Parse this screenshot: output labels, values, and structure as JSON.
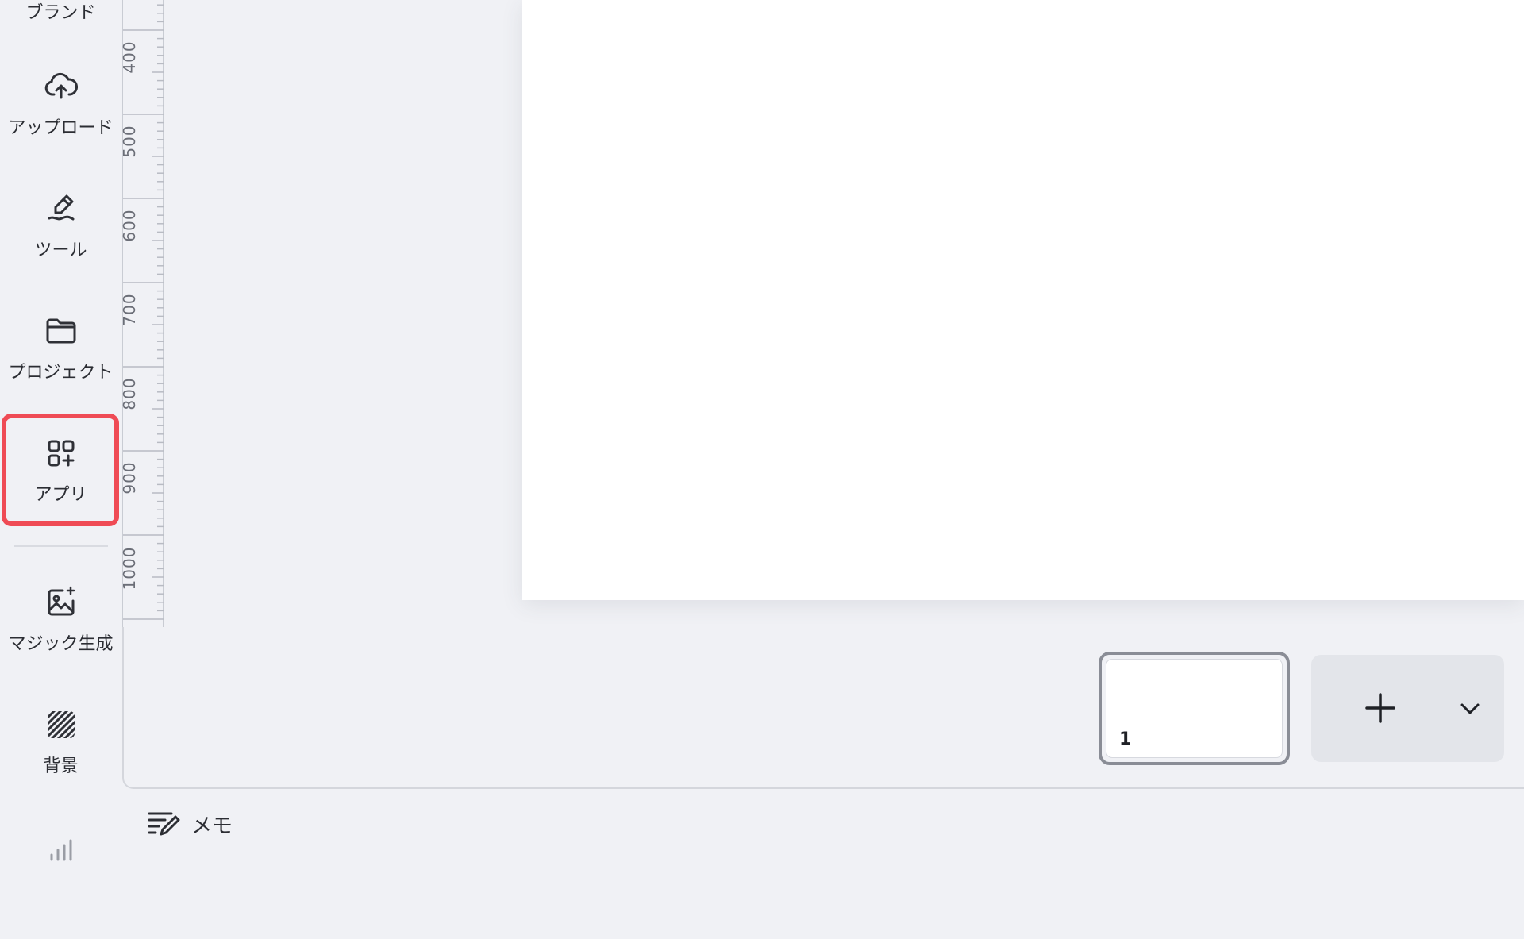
{
  "sidebar": {
    "items": [
      {
        "label": "ブランド",
        "icon": "brand-icon"
      },
      {
        "label": "アップロード",
        "icon": "cloud-upload-icon"
      },
      {
        "label": "ツール",
        "icon": "pen-tool-icon"
      },
      {
        "label": "プロジェクト",
        "icon": "folder-icon"
      },
      {
        "label": "アプリ",
        "icon": "apps-grid-plus-icon"
      },
      {
        "label": "マジック生成",
        "icon": "magic-image-icon"
      },
      {
        "label": "背景",
        "icon": "hatched-background-icon"
      },
      {
        "label": "",
        "icon": "bar-chart-icon"
      }
    ],
    "highlighted_item": "アプリ",
    "highlight_color": "#ef4b55"
  },
  "ruler": {
    "labels": [
      "400",
      "500",
      "600",
      "700",
      "800",
      "900",
      "1000"
    ]
  },
  "page_bar": {
    "current_page_number": "1",
    "add_page_icon": "plus-icon",
    "options_icon": "chevron-down-icon"
  },
  "notes": {
    "label": "メモ",
    "icon": "notes-edit-icon"
  }
}
